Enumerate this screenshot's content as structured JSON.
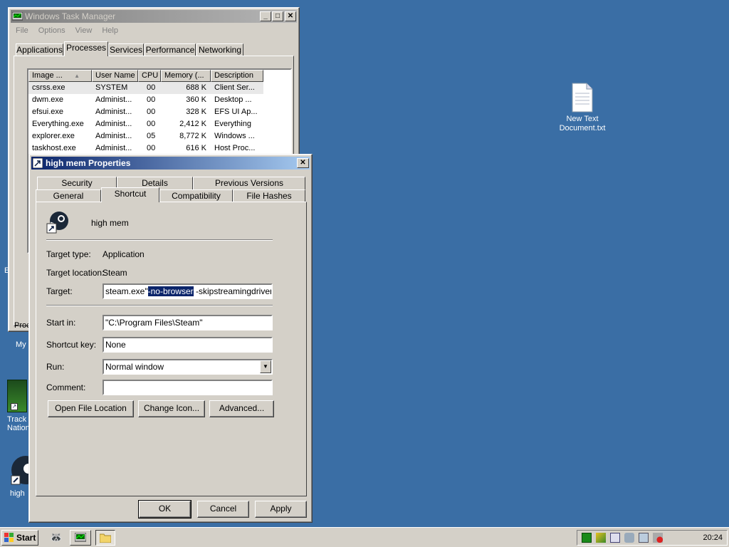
{
  "task_manager": {
    "title": "Windows Task Manager",
    "menu": [
      "File",
      "Options",
      "View",
      "Help"
    ],
    "tabs": [
      "Applications",
      "Processes",
      "Services",
      "Performance",
      "Networking"
    ],
    "columns": [
      "Image ...",
      "User Name",
      "CPU",
      "Memory (...",
      "Description"
    ],
    "rows": [
      [
        "csrss.exe",
        "SYSTEM",
        "00",
        "688 K",
        "Client Ser..."
      ],
      [
        "dwm.exe",
        "Administ...",
        "00",
        "360 K",
        "Desktop ..."
      ],
      [
        "efsui.exe",
        "Administ...",
        "00",
        "328 K",
        "EFS UI Ap..."
      ],
      [
        "Everything.exe",
        "Administ...",
        "00",
        "2,412 K",
        "Everything"
      ],
      [
        "explorer.exe",
        "Administ...",
        "05",
        "8,772 K",
        "Windows ..."
      ],
      [
        "taskhost.exe",
        "Administ...",
        "00",
        "616 K",
        "Host Proc..."
      ]
    ],
    "status_partial": "Proce"
  },
  "properties": {
    "title": "high mem Properties",
    "tabs_top": [
      "Security",
      "Details",
      "Previous Versions"
    ],
    "tabs_bottom": [
      "General",
      "Shortcut",
      "Compatibility",
      "File Hashes"
    ],
    "shortcut_name": "high mem",
    "target_type_label": "Target type:",
    "target_type_value": "Application",
    "target_location_label": "Target location:",
    "target_location_value": "Steam",
    "target_label": "Target:",
    "target_before": "steam.exe\"",
    "target_selected": "-no-browser",
    "target_after": " -skipstreamingdrivers -vrdi",
    "start_in_label": "Start in:",
    "start_in_value": "\"C:\\Program Files\\Steam\"",
    "shortcut_key_label": "Shortcut key:",
    "shortcut_key_value": "None",
    "run_label": "Run:",
    "run_value": "Normal window",
    "comment_label": "Comment:",
    "comment_value": "",
    "open_file_location": "Open File Location",
    "change_icon": "Change Icon...",
    "advanced": "Advanced...",
    "ok": "OK",
    "cancel": "Cancel",
    "apply": "Apply"
  },
  "desktop": {
    "new_text_doc": [
      "New Text",
      "Document.txt"
    ],
    "partial_left": [
      "My",
      "Track",
      "Nation",
      "high"
    ]
  },
  "taskbar": {
    "start": "Start",
    "clock": "20:24"
  },
  "colors": {
    "desktop": "#3a6ea5",
    "active_title": "#0a246a",
    "selection": "#0a246a"
  }
}
